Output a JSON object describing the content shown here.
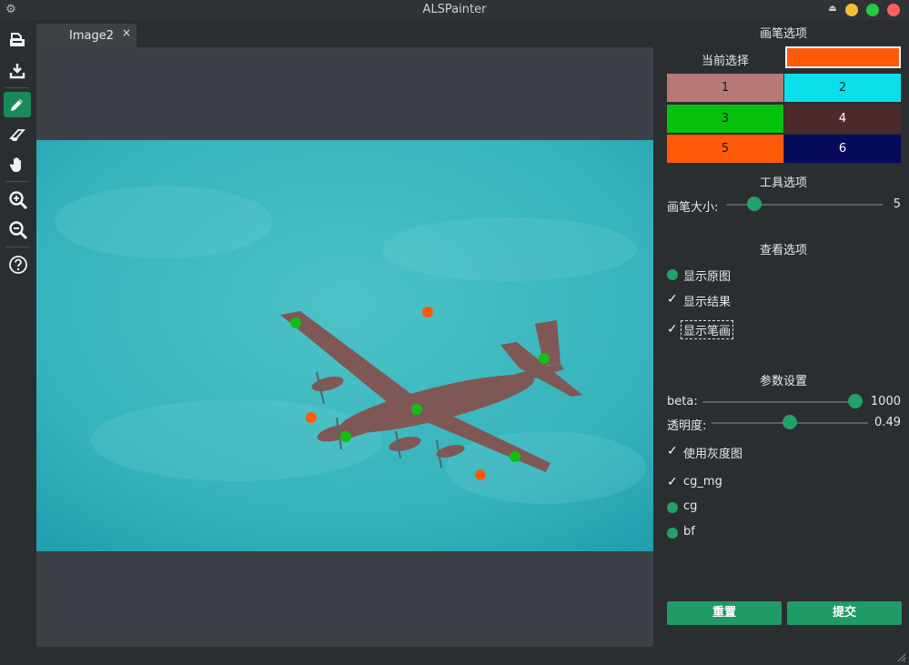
{
  "app": {
    "title": "ALSPainter",
    "settings_icon": "gear-icon",
    "window_controls": [
      {
        "name": "minimize",
        "color": "#f5bf2f"
      },
      {
        "name": "maximize",
        "color": "#27c93f"
      },
      {
        "name": "close",
        "color": "#ff5f57"
      }
    ]
  },
  "toolbar": {
    "tools": [
      {
        "name": "open-image",
        "icon": "open-file-icon",
        "active": false
      },
      {
        "name": "save-image",
        "icon": "download-icon",
        "active": false
      },
      {
        "name": "pen",
        "icon": "pencil-icon",
        "active": true
      },
      {
        "name": "eraser",
        "icon": "eraser-icon",
        "active": false
      },
      {
        "name": "pan",
        "icon": "hand-icon",
        "active": false
      },
      {
        "name": "zoom-in",
        "icon": "zoom-in-icon",
        "active": false
      },
      {
        "name": "zoom-out",
        "icon": "zoom-out-icon",
        "active": false
      },
      {
        "name": "help",
        "icon": "help-icon",
        "active": false
      }
    ]
  },
  "tabs": [
    {
      "label": "Image2",
      "close": "×"
    }
  ],
  "brush": {
    "section_title": "画笔选项",
    "current_label": "当前选择",
    "current_color": "#ff5a0a",
    "swatches": [
      {
        "label": "1",
        "color": "#b77878",
        "text_color": "#1a1a1a"
      },
      {
        "label": "2",
        "color": "#0be0ea",
        "text_color": "#1a1a1a"
      },
      {
        "label": "3",
        "color": "#05c10c",
        "text_color": "#1a1a1a"
      },
      {
        "label": "4",
        "color": "#4c2a2a",
        "text_color": "#ffffff"
      },
      {
        "label": "5",
        "color": "#ff5a0a",
        "text_color": "#1a1a1a"
      },
      {
        "label": "6",
        "color": "#050a5a",
        "text_color": "#ffffff"
      }
    ]
  },
  "tool_options": {
    "section_title": "工具选项",
    "brush_size_label": "画笔大小:",
    "brush_size": {
      "value": "5",
      "min": 1,
      "max": 100,
      "current": 5
    }
  },
  "view_options": {
    "section_title": "查看选项",
    "items": [
      {
        "label": "显示原图",
        "type": "radio",
        "checked": false
      },
      {
        "label": "显示结果",
        "type": "checkbox",
        "checked": true
      },
      {
        "label": "显示笔画",
        "type": "checkbox",
        "checked": true,
        "focused": true
      }
    ]
  },
  "params": {
    "section_title": "参数设置",
    "beta_label": "beta:",
    "beta": {
      "value": "1000",
      "fraction": 1.0
    },
    "opacity_label": "透明度:",
    "opacity": {
      "value": "0.49",
      "fraction": 0.49
    },
    "grayscale_label": "使用灰度图",
    "grayscale_checked": true,
    "methods": [
      {
        "label": "cg_mg",
        "type": "checkbox",
        "checked": true
      },
      {
        "label": "cg",
        "type": "radio",
        "checked": false
      },
      {
        "label": "bf",
        "type": "radio",
        "checked": false
      }
    ]
  },
  "actions": {
    "reset_label": "重置",
    "submit_label": "提交"
  },
  "strokes": {
    "green": "#11c011",
    "orange": "#ff5a0a"
  }
}
